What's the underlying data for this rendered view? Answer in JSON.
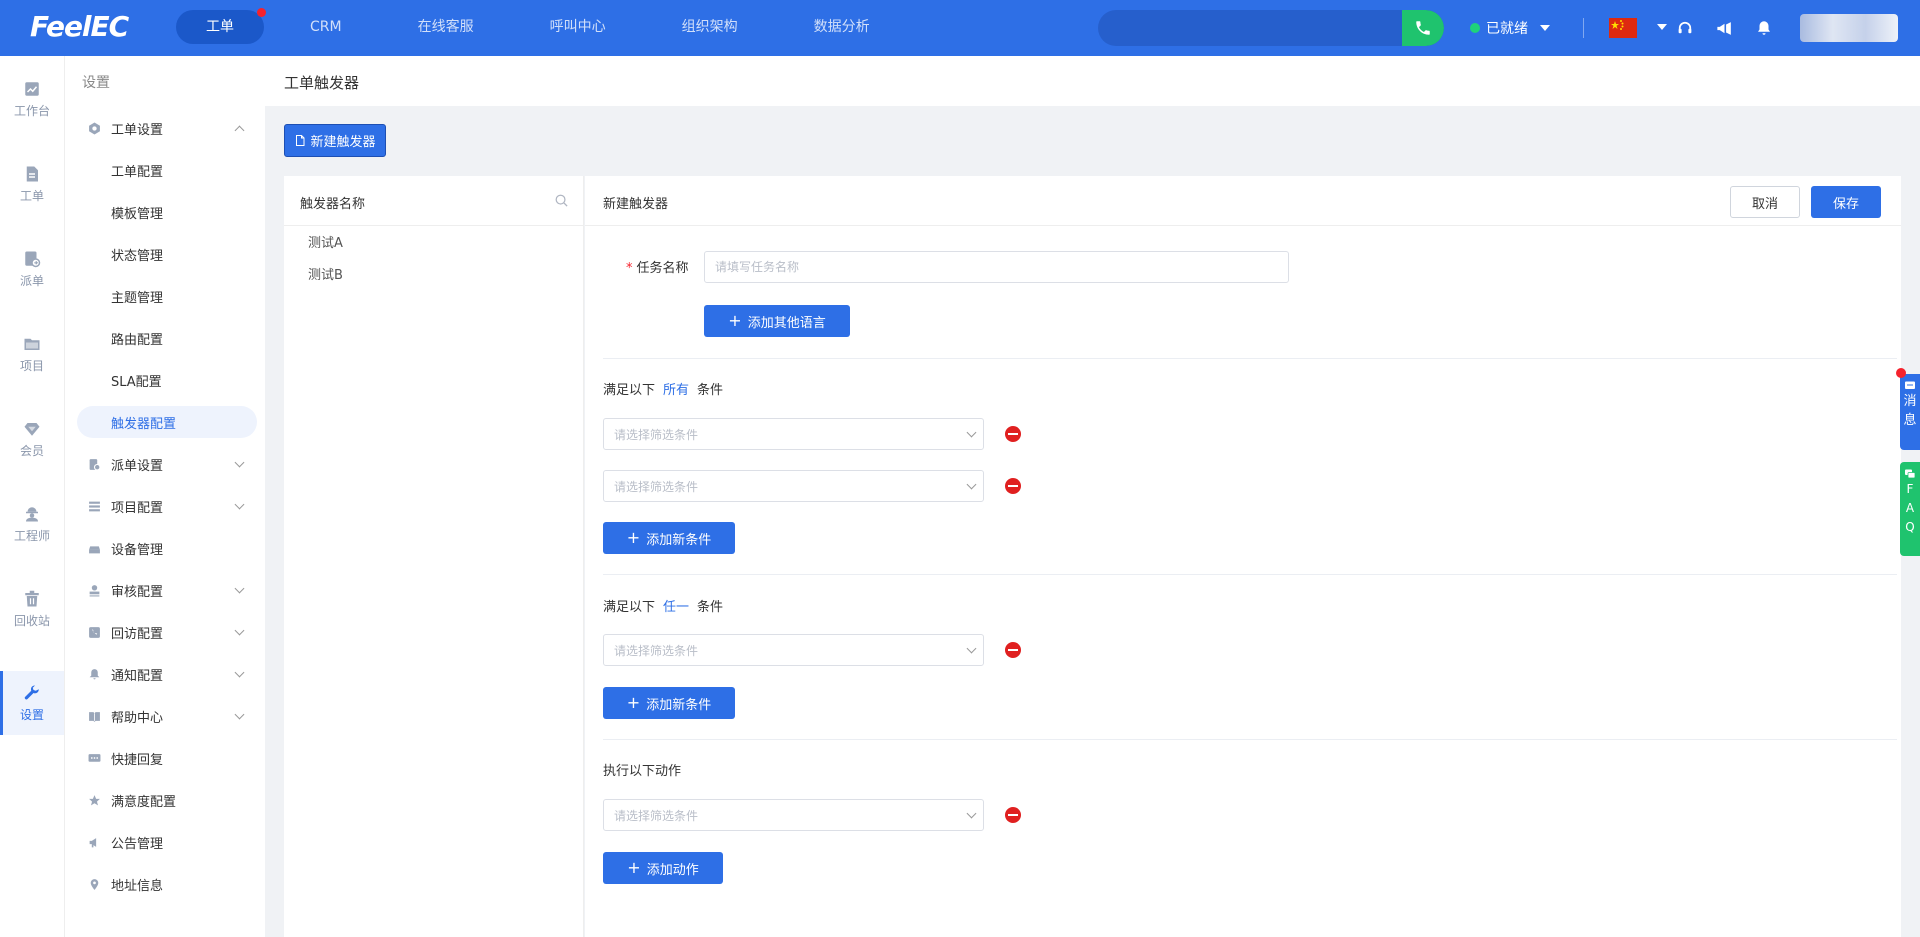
{
  "app": {
    "logo": "FeelEC"
  },
  "topnav": {
    "items": [
      {
        "label": "工单",
        "active": true,
        "badge": true
      },
      {
        "label": "CRM"
      },
      {
        "label": "在线客服"
      },
      {
        "label": "呼叫中心"
      },
      {
        "label": "组织架构"
      },
      {
        "label": "数据分析"
      }
    ],
    "search_value": "",
    "status": "已就绪"
  },
  "rail": {
    "items": [
      {
        "label": "工作台",
        "icon": "chart-icon"
      },
      {
        "label": "工单",
        "icon": "document-icon"
      },
      {
        "label": "派单",
        "icon": "dispatch-icon"
      },
      {
        "label": "项目",
        "icon": "folder-icon"
      },
      {
        "label": "会员",
        "icon": "diamond-icon"
      },
      {
        "label": "工程师",
        "icon": "engineer-icon"
      },
      {
        "label": "回收站",
        "icon": "trash-icon"
      },
      {
        "label": "设置",
        "icon": "wrench-icon",
        "active": true
      }
    ]
  },
  "menu": {
    "title": "设置",
    "items": [
      {
        "label": "工单设置",
        "expanded": true
      },
      {
        "label": "工单配置",
        "sub": true
      },
      {
        "label": "模板管理",
        "sub": true
      },
      {
        "label": "状态管理",
        "sub": true
      },
      {
        "label": "主题管理",
        "sub": true
      },
      {
        "label": "路由配置",
        "sub": true
      },
      {
        "label": "SLA配置",
        "sub": true
      },
      {
        "label": "触发器配置",
        "sub": true,
        "active": true
      },
      {
        "label": "派单设置",
        "chevron": true
      },
      {
        "label": "项目配置",
        "chevron": true
      },
      {
        "label": "设备管理"
      },
      {
        "label": "审核配置",
        "chevron": true
      },
      {
        "label": "回访配置",
        "chevron": true
      },
      {
        "label": "通知配置",
        "chevron": true
      },
      {
        "label": "帮助中心",
        "chevron": true
      },
      {
        "label": "快捷回复"
      },
      {
        "label": "满意度配置"
      },
      {
        "label": "公告管理"
      },
      {
        "label": "地址信息"
      }
    ]
  },
  "page": {
    "title": "工单触发器",
    "new_button": "新建触发器"
  },
  "list": {
    "header": "触发器名称",
    "rows": [
      "测试A",
      "测试B"
    ]
  },
  "form": {
    "title": "新建触发器",
    "cancel": "取消",
    "save": "保存",
    "task_name_label": "任务名称",
    "task_name_placeholder": "请填写任务名称",
    "add_language": "添加其他语言",
    "all_section": {
      "prefix": "满足以下",
      "keyword": "所有",
      "suffix": "条件"
    },
    "any_section": {
      "prefix": "满足以下",
      "keyword": "任一",
      "suffix": "条件"
    },
    "action_section": "执行以下动作",
    "select_placeholder": "请选择筛选条件",
    "add_condition": "添加新条件",
    "add_action": "添加动作"
  },
  "float": {
    "message": [
      "消",
      "息"
    ],
    "faq": [
      "F",
      "A",
      "Q"
    ]
  },
  "colors": {
    "primary": "#2e6fe6",
    "green": "#1fc36e",
    "danger": "#e02020"
  }
}
